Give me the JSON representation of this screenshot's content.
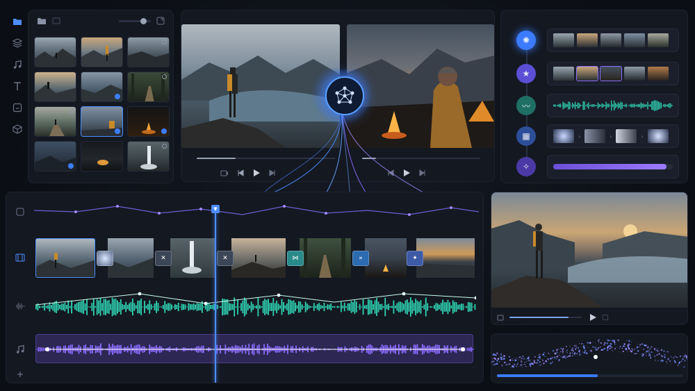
{
  "rail": {
    "items": [
      {
        "icon": "folder-icon",
        "glyph": "▆",
        "active": true
      },
      {
        "icon": "layers-icon",
        "glyph": "◈",
        "active": false
      },
      {
        "icon": "music-icon",
        "glyph": "♫",
        "active": false
      },
      {
        "icon": "text-icon",
        "glyph": "T",
        "active": false
      },
      {
        "icon": "sticker-icon",
        "glyph": "▢",
        "active": false
      },
      {
        "icon": "cube-icon",
        "glyph": "⬡",
        "active": false
      }
    ]
  },
  "bin": {
    "folder_icon": "▆",
    "bin_icon": "▭",
    "expand_icon": "⧉",
    "zoom_level": 0.75
  },
  "viewers": {
    "left": {
      "progress": 0.28
    },
    "right": {
      "progress": 0.12
    }
  },
  "tools": [
    {
      "name": "ai-analyze",
      "icon": "neural-icon",
      "glyph": "✺",
      "color": "#3b7bff"
    },
    {
      "name": "ai-highlights",
      "icon": "star-icon",
      "glyph": "★",
      "color": "#5b4fd6"
    },
    {
      "name": "ai-audio",
      "icon": "waveform-icon",
      "glyph": "〰",
      "color": "#1f8a7a"
    },
    {
      "name": "ai-transitions",
      "icon": "film-icon",
      "glyph": "▦",
      "color": "#3b6bd6"
    },
    {
      "name": "ai-magic",
      "icon": "magic-wand-icon",
      "glyph": "✧",
      "color": "#6b4fd6"
    }
  ],
  "tool_effects": {
    "progress": 0.95
  },
  "timeline": {
    "playhead_icon": "▼",
    "track_icons": [
      {
        "icon": "scale-icon",
        "glyph": "⌗"
      },
      {
        "icon": "film-strip-icon",
        "glyph": "▦"
      },
      {
        "icon": "audio-wave-icon",
        "glyph": "|||"
      },
      {
        "icon": "music-note-icon",
        "glyph": "♫"
      },
      {
        "icon": "add-track-icon",
        "glyph": "+"
      }
    ],
    "transitions": [
      {
        "icon": "blur-transition-icon",
        "glyph": "◎"
      },
      {
        "icon": "cross-transition-icon",
        "glyph": "✕"
      },
      {
        "icon": "cross-transition-icon",
        "glyph": "✕"
      },
      {
        "icon": "bowtie-transition-icon",
        "glyph": "⋈"
      },
      {
        "icon": "fast-forward-icon",
        "glyph": "»"
      },
      {
        "icon": "light-leak-icon",
        "glyph": "✦"
      }
    ]
  },
  "preview": {
    "progress": 0.82
  },
  "render": {
    "progress": 0.54
  },
  "colors": {
    "accent_blue": "#4d8dff",
    "accent_teal": "#2fd0b0",
    "accent_purple": "#8b6bff"
  }
}
